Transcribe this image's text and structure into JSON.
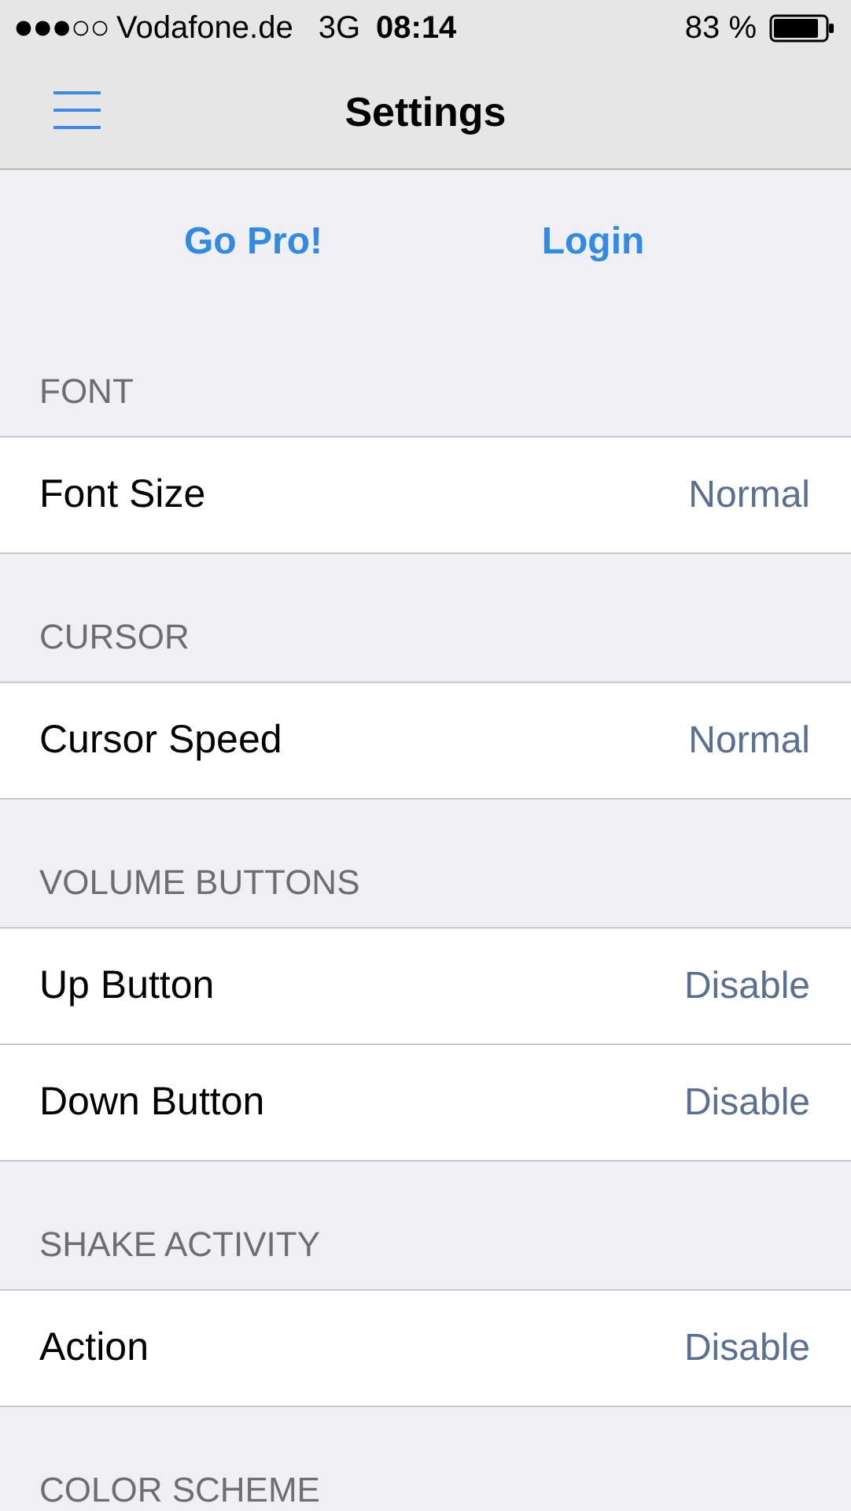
{
  "status_bar": {
    "carrier": "Vodafone.de",
    "network": "3G",
    "time": "08:14",
    "battery": "83 %"
  },
  "nav": {
    "title": "Settings"
  },
  "actions": [
    "Go Pro!",
    "Login"
  ],
  "sections": [
    {
      "header": "FONT",
      "rows": [
        {
          "label": "Font Size",
          "value": "Normal"
        }
      ]
    },
    {
      "header": "CURSOR",
      "rows": [
        {
          "label": "Cursor Speed",
          "value": "Normal"
        }
      ]
    },
    {
      "header": "VOLUME BUTTONS",
      "rows": [
        {
          "label": "Up Button",
          "value": "Disable"
        },
        {
          "label": "Down Button",
          "value": "Disable"
        }
      ]
    },
    {
      "header": "SHAKE ACTIVITY",
      "rows": [
        {
          "label": "Action",
          "value": "Disable"
        }
      ]
    },
    {
      "header": "COLOR SCHEME"
    }
  ]
}
